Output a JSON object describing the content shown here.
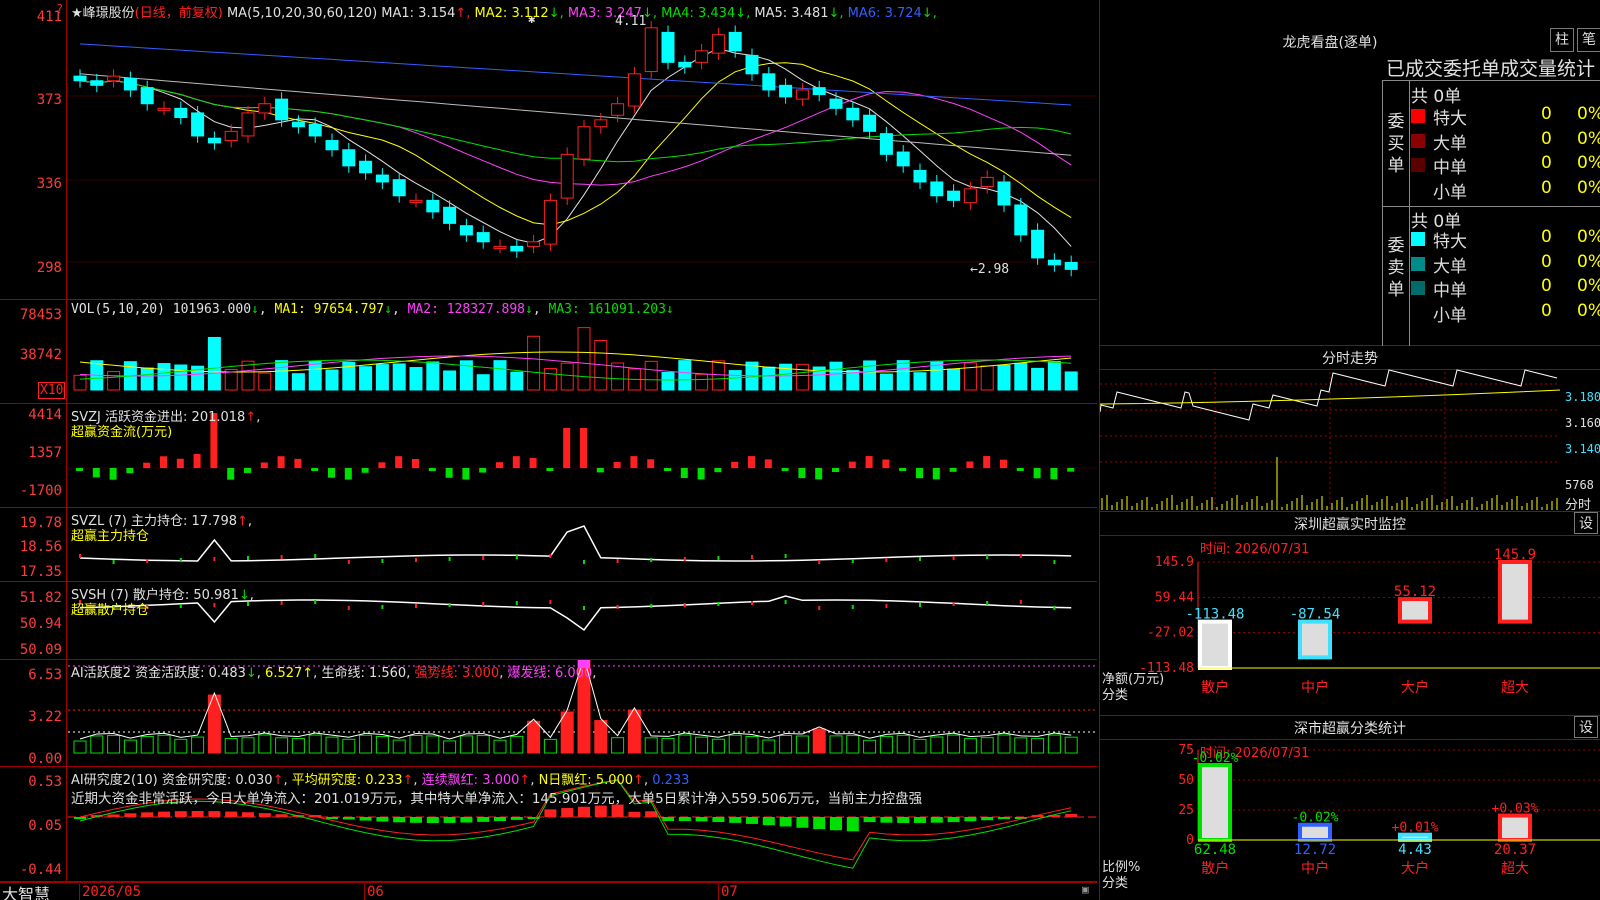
{
  "stock": {
    "name": "峰璟股份",
    "mode": "(日线，前复权)",
    "star": "★",
    "ma_prefix": "MA(5,10,20,30,60,120)",
    "ma": [
      {
        "label": "MA1:",
        "value": "3.154",
        "arrow": "↑",
        "color": "#e0e0e0"
      },
      {
        "label": "MA2:",
        "value": "3.112",
        "arrow": "↓",
        "color": "#ffff00"
      },
      {
        "label": "MA3:",
        "value": "3.247",
        "arrow": "↓",
        "color": "#ff40ff"
      },
      {
        "label": "MA4:",
        "value": "3.434",
        "arrow": "↓",
        "color": "#00e000"
      },
      {
        "label": "MA5:",
        "value": "3.481",
        "arrow": "↓",
        "color": "#e0e0e0"
      },
      {
        "label": "MA6:",
        "value": "3.724",
        "arrow": "↓",
        "color": "#3060ff"
      }
    ],
    "high_mark": "4.11",
    "low_mark": "←2.98",
    "corner_top": "4",
    "corner_flag": "?"
  },
  "price_ticks": [
    "411",
    "373",
    "336",
    "298"
  ],
  "vol": {
    "prefix": "VOL(5,10,20)",
    "value": "101963.000",
    "ma1": "97654.797",
    "ma2": "128327.898",
    "ma3": "161091.203",
    "ticks": [
      "78453",
      "38742"
    ],
    "unit": "X10"
  },
  "svzj": {
    "title": "SVZJ 活跃资金进出:",
    "value": "201.018",
    "sub": "超赢资金流(万元)",
    "ticks": [
      "4414",
      "1357",
      "-1700"
    ]
  },
  "svzl": {
    "title": "SVZL (7) 主力持仓:",
    "value": "17.798",
    "sub": "超赢主力持仓",
    "ticks": [
      "19.78",
      "18.56",
      "17.35"
    ]
  },
  "svsh": {
    "title": "SVSH (7) 散户持仓:",
    "value": "50.981",
    "sub": "超赢散户持仓",
    "ticks": [
      "51.82",
      "50.94",
      "50.09"
    ]
  },
  "ai2": {
    "title": "AI活跃度2 资金活跃度:",
    "v1": "0.483",
    "v2": "6.527",
    "life_label": "生命线:",
    "life": "1.560",
    "strong_label": "强势线:",
    "strong": "3.000",
    "burst_label": "爆发线:",
    "burst": "6.000",
    "ticks": [
      "6.53",
      "3.22",
      "0.00"
    ]
  },
  "ai_res": {
    "title": "AI研究度2(10) 资金研究度:",
    "v1": "0.030",
    "avg_label": "平均研究度:",
    "avg": "0.233",
    "red_label": "连续飘红:",
    "red": "3.000",
    "n_label": "N日飘红:",
    "n": "5.000",
    "last": "0.233",
    "summary": "近期大资金非常活跃，今日大单净流入：201.019万元，其中特大单净流入：145.901万元，大单5日累计净入559.506万元，当前主力控盘强",
    "ticks": [
      "0.53",
      "0.05",
      "-0.44"
    ]
  },
  "footer": {
    "brand": "大智慧",
    "dates": [
      "2026/05",
      "06",
      "07"
    ]
  },
  "lhb": {
    "title": "龙虎看盘(逐单)",
    "btn1": "柱",
    "btn2": "笔",
    "subtitle": "已成交委托单成交量统计",
    "buy_label": "委买单",
    "sell_label": "委卖单",
    "buy_total": "共 0单",
    "sell_total": "共 0单",
    "buy_rows": [
      {
        "name": "特大",
        "count": "0",
        "pct": "0%",
        "color": "#ff0000"
      },
      {
        "name": "大单",
        "count": "0",
        "pct": "0%",
        "color": "#8b0000"
      },
      {
        "name": "中单",
        "count": "0",
        "pct": "0%",
        "color": "#5a0000"
      },
      {
        "name": "小单",
        "count": "0",
        "pct": "0%",
        "color": "#000000"
      }
    ],
    "sell_rows": [
      {
        "name": "特大",
        "count": "0",
        "pct": "0%",
        "color": "#00ffff"
      },
      {
        "name": "大单",
        "count": "0",
        "pct": "0%",
        "color": "#008b8b"
      },
      {
        "name": "中单",
        "count": "0",
        "pct": "0%",
        "color": "#006b6b"
      },
      {
        "name": "小单",
        "count": "0",
        "pct": "0%",
        "color": "#000000"
      }
    ]
  },
  "intraday": {
    "title": "分时走势",
    "price_ticks": [
      "3.180",
      "3.160",
      "3.140"
    ],
    "vol_tick": "5768",
    "vol_label": "分时"
  },
  "sz_monitor": {
    "title": "深圳超赢实时监控",
    "btn": "设",
    "time": "时间: 2026/07/31",
    "yticks": [
      "145.9",
      "59.44",
      "-27.02",
      "-113.48"
    ],
    "ylabel": "净额(万元)",
    "xlabel": "分类",
    "categories": [
      "散户",
      "中户",
      "大户",
      "超大"
    ],
    "values": [
      -113.48,
      -87.54,
      55.12,
      145.9
    ],
    "value_labels": [
      "-113.48",
      "-87.54",
      "55.12",
      "145.9"
    ]
  },
  "sz_class": {
    "title": "深市超赢分类统计",
    "btn": "设",
    "time": "时间: 2026/07/31",
    "yticks": [
      "75",
      "50",
      "25",
      "0"
    ],
    "ylabel": "比例%",
    "xlabel": "分类",
    "categories": [
      "散户",
      "中户",
      "大户",
      "超大"
    ],
    "values": [
      62.48,
      12.72,
      4.43,
      20.37
    ],
    "top_labels": [
      "-0.02%",
      "-0.02%",
      "+0.01%",
      "+0.03%"
    ],
    "bottom_labels": [
      "62.48",
      "12.72",
      "4.43",
      "20.37"
    ]
  },
  "chart_data": [
    {
      "type": "candlestick",
      "title": "峰璟股份 (日线，前复权)",
      "x": [
        "2026/05",
        "06",
        "07"
      ],
      "ylim": [
        2.98,
        4.11
      ],
      "annotations": [
        "4.11",
        "2.98"
      ],
      "series": [
        {
          "name": "MA1",
          "last": 3.154
        },
        {
          "name": "MA2",
          "last": 3.112
        },
        {
          "name": "MA3",
          "last": 3.247
        },
        {
          "name": "MA4",
          "last": 3.434
        },
        {
          "name": "MA5",
          "last": 3.481
        },
        {
          "name": "MA6",
          "last": 3.724
        }
      ]
    },
    {
      "type": "bar",
      "title": "深圳超赢实时监控",
      "categories": [
        "散户",
        "中户",
        "大户",
        "超大"
      ],
      "values": [
        -113.48,
        -87.54,
        55.12,
        145.9
      ],
      "ylabel": "净额(万元)",
      "xlabel": "分类",
      "ylim": [
        -113.48,
        145.9
      ]
    },
    {
      "type": "bar",
      "title": "深市超赢分类统计",
      "categories": [
        "散户",
        "中户",
        "大户",
        "超大"
      ],
      "values": [
        62.48,
        12.72,
        4.43,
        20.37
      ],
      "ylabel": "比例%",
      "xlabel": "分类",
      "ylim": [
        0,
        75
      ]
    }
  ],
  "colors": {
    "up": "#ff2020",
    "down": "#00ffff",
    "grid": "#a00000",
    "ma1": "#e0e0e0",
    "ma2": "#ffff00",
    "ma3": "#ff40ff",
    "ma4": "#00e000",
    "ma5": "#bbbbbb",
    "ma6": "#3060ff"
  }
}
